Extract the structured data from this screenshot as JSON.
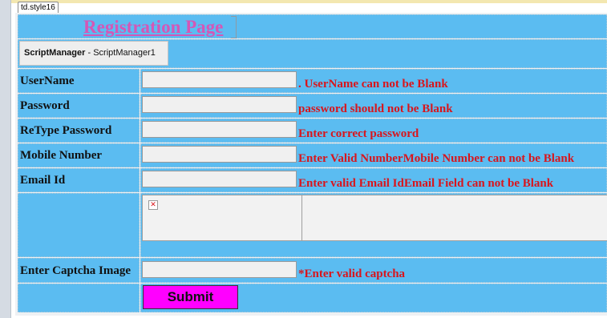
{
  "designer": {
    "selected_element_tag": "td.style16"
  },
  "header": {
    "title": "Registration Page"
  },
  "script_manager": {
    "type": "ScriptManager",
    "id": "ScriptManager1"
  },
  "fields": [
    {
      "label": "UserName",
      "value": "",
      "error": ". UserName can not be Blank"
    },
    {
      "label": "Password",
      "value": "",
      "error": "password should not be Blank"
    },
    {
      "label": "ReType Password",
      "value": "",
      "error": "Enter correct password"
    },
    {
      "label": "Mobile Number",
      "value": "",
      "error": "Enter Valid NumberMobile Number can not be Blank"
    },
    {
      "label": "Email Id",
      "value": "",
      "error": "Enter valid Email IdEmail Field can not be Blank"
    }
  ],
  "captcha": {
    "image_icon": "broken-image-icon",
    "label": "Enter Captcha Image",
    "value": "",
    "error": "*Enter valid captcha"
  },
  "submit": {
    "label": "Submit"
  },
  "colors": {
    "row_background": "#5bbcf1",
    "title": "#d457b6",
    "error": "#d9151c",
    "submit_button": "#ff00ff"
  }
}
